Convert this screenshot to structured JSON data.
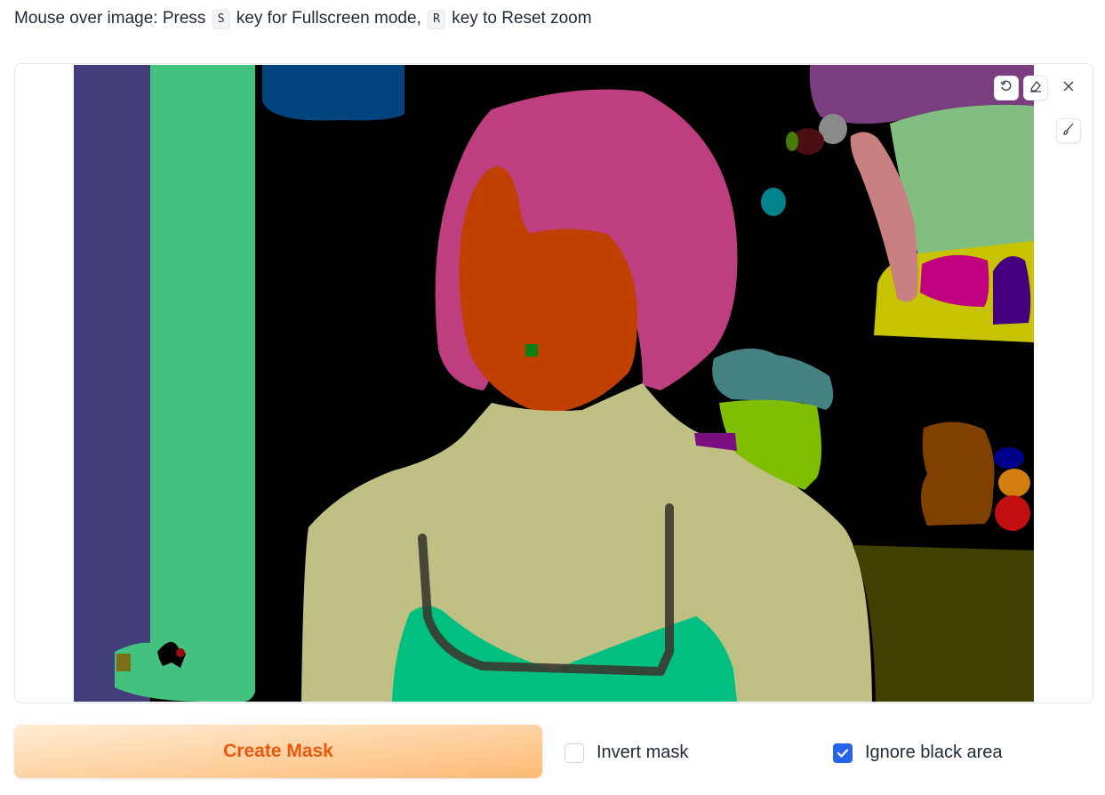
{
  "hint": {
    "prefix": "Mouse over image: Press",
    "key1": "S",
    "middle": "key for Fullscreen mode,",
    "key2": "R",
    "suffix": "key to Reset zoom"
  },
  "toolbar": {
    "undo_icon": "undo-icon",
    "eraser_icon": "eraser-icon",
    "close_icon": "close-icon",
    "brush_icon": "brush-icon"
  },
  "create_mask": {
    "label": "Create Mask",
    "color": "#ea580c"
  },
  "invert_mask": {
    "label": "Invert mask",
    "checked": false
  },
  "ignore_black": {
    "label": "Ignore black area",
    "checked": true,
    "accent": "#2563eb"
  }
}
